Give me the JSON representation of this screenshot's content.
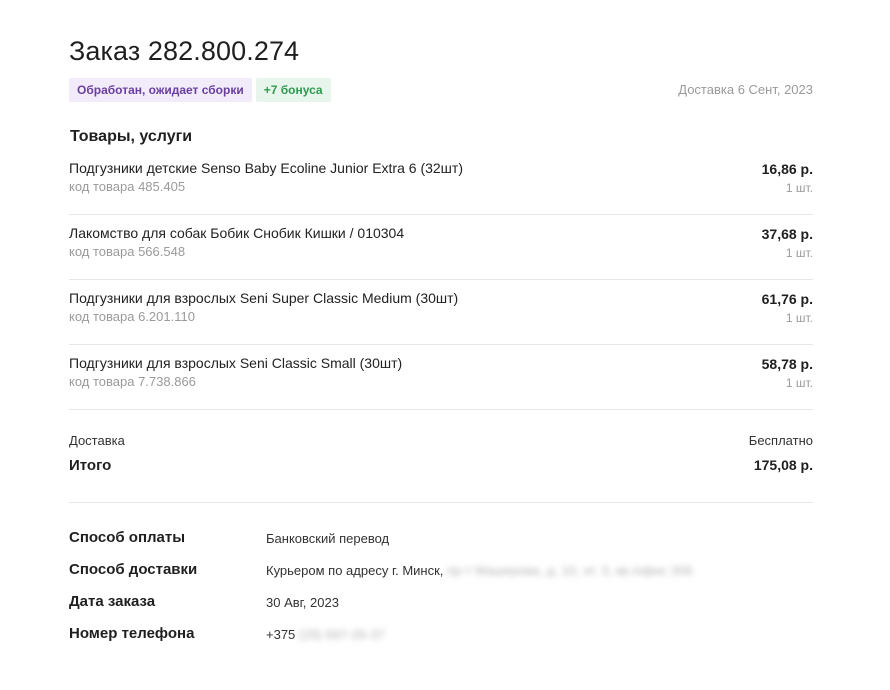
{
  "order": {
    "title": "Заказ 282.800.274",
    "status_badge": "Обработан, ожидает сборки",
    "bonus_badge": "+7 бонуса",
    "delivery_date": "Доставка 6 Сент, 2023"
  },
  "goods": {
    "section_title": "Товары, услуги",
    "items": [
      {
        "name": "Подгузники детские Senso Baby Ecoline Junior Extra 6 (32шт)",
        "code": "код товара 485.405",
        "price": "16,86 р.",
        "qty": "1 шт."
      },
      {
        "name": "Лакомство для собак Бобик Снобик Кишки / 010304",
        "code": "код товара 566.548",
        "price": "37,68 р.",
        "qty": "1 шт."
      },
      {
        "name": "Подгузники для взрослых Seni Super Classic Medium (30шт)",
        "code": "код товара 6.201.110",
        "price": "61,76 р.",
        "qty": "1 шт."
      },
      {
        "name": "Подгузники для взрослых Seni Classic Small (30шт)",
        "code": "код товара 7.738.866",
        "price": "58,78 р.",
        "qty": "1 шт."
      }
    ]
  },
  "totals": {
    "delivery_label": "Доставка",
    "delivery_value": "Бесплатно",
    "total_label": "Итого",
    "total_value": "175,08 р."
  },
  "details": {
    "payment_label": "Способ оплаты",
    "payment_value": "Банковский перевод",
    "shipping_label": "Способ доставки",
    "shipping_value": "Курьером по адресу г. Минск,",
    "shipping_value_hidden": "пр-т Машерова, д. 10, эт. 3, кв./офис 306",
    "order_date_label": "Дата заказа",
    "order_date_value": "30 Авг, 2023",
    "phone_label": "Номер телефона",
    "phone_value": "+375",
    "phone_value_hidden": "(29) 697-26-37"
  }
}
